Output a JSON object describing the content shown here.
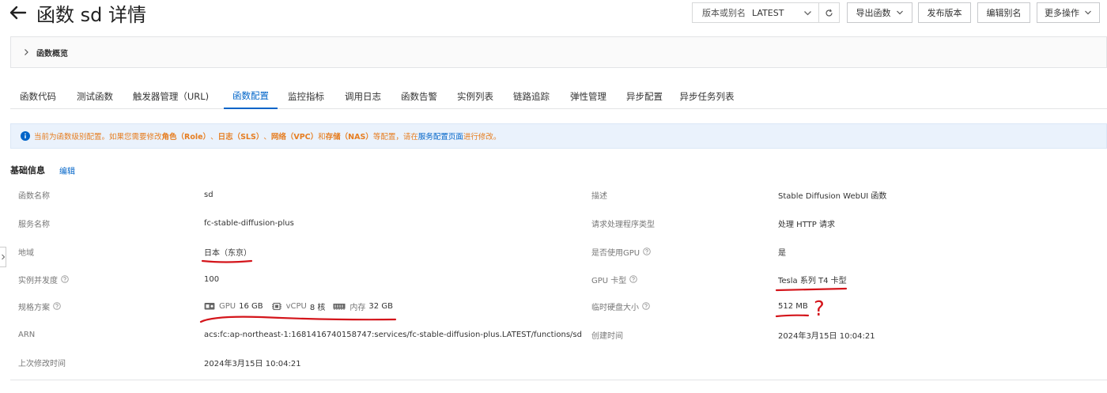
{
  "header": {
    "title": "函数 sd 详情",
    "version_label": "版本或别名",
    "version_value": "LATEST",
    "buttons": {
      "export": "导出函数",
      "publish": "发布版本",
      "edit_alias": "编辑别名",
      "more": "更多操作"
    }
  },
  "overview": {
    "label": "函数概览"
  },
  "tabs": [
    {
      "label": "函数代码"
    },
    {
      "label": "测试函数"
    },
    {
      "label": "触发器管理（URL)"
    },
    {
      "label": "函数配置"
    },
    {
      "label": "监控指标"
    },
    {
      "label": "调用日志"
    },
    {
      "label": "函数告警"
    },
    {
      "label": "实例列表"
    },
    {
      "label": "链路追踪"
    },
    {
      "label": "弹性管理"
    },
    {
      "label": "异步配置"
    },
    {
      "label": "异步任务列表"
    }
  ],
  "active_tab": "函数配置",
  "notice": {
    "p1": "当前为函数级别配置。如果您需要修改",
    "role": "角色（Role）",
    "sep1": "、",
    "log": "日志（SLS）",
    "sep2": "、",
    "net": "网络（VPC）",
    "and": "和",
    "storage": "存储（NAS）",
    "p2": "等配置，请在",
    "link": "服务配置页面",
    "p3": "进行修改。"
  },
  "basic_info": {
    "title": "基础信息",
    "edit": "编辑",
    "left": [
      {
        "label": "函数名称",
        "value": "sd"
      },
      {
        "label": "服务名称",
        "value": "fc-stable-diffusion-plus"
      },
      {
        "label": "地域",
        "value": "日本（东京）"
      },
      {
        "label": "实例并发度",
        "value": "100"
      },
      {
        "label": "规格方案",
        "value": ""
      },
      {
        "label": "ARN",
        "value": "acs:fc:ap-northeast-1:1681416740158747:services/fc-stable-diffusion-plus.LATEST/functions/sd"
      },
      {
        "label": "上次修改时间",
        "value": "2024年3月15日 10:04:21"
      }
    ],
    "right": [
      {
        "label": "描述",
        "value": "Stable Diffusion WebUI 函数"
      },
      {
        "label": "请求处理程序类型",
        "value": "处理 HTTP 请求"
      },
      {
        "label": "是否使用GPU",
        "value": "是"
      },
      {
        "label": "GPU 卡型",
        "value": "Tesla 系列 T4 卡型"
      },
      {
        "label": "临时硬盘大小",
        "value": "512 MB"
      },
      {
        "label": "创建时间",
        "value": "2024年3月15日 10:04:21"
      }
    ],
    "spec": {
      "gpu_label": "GPU",
      "gpu_value": "16 GB",
      "vcpu_label": "vCPU",
      "vcpu_value": "8 核",
      "mem_label": "内存",
      "mem_value": "32 GB"
    }
  },
  "annotation": {
    "question_mark": "?"
  },
  "colors": {
    "primary": "#0064c8",
    "warning": "#e67e22",
    "annotation": "#d4151b"
  },
  "icons": [
    "back-arrow-icon",
    "chevron-down-icon",
    "refresh-icon",
    "chevron-right-icon",
    "info-icon",
    "question-icon",
    "gpu-card-icon",
    "cpu-chip-icon",
    "memory-icon"
  ]
}
